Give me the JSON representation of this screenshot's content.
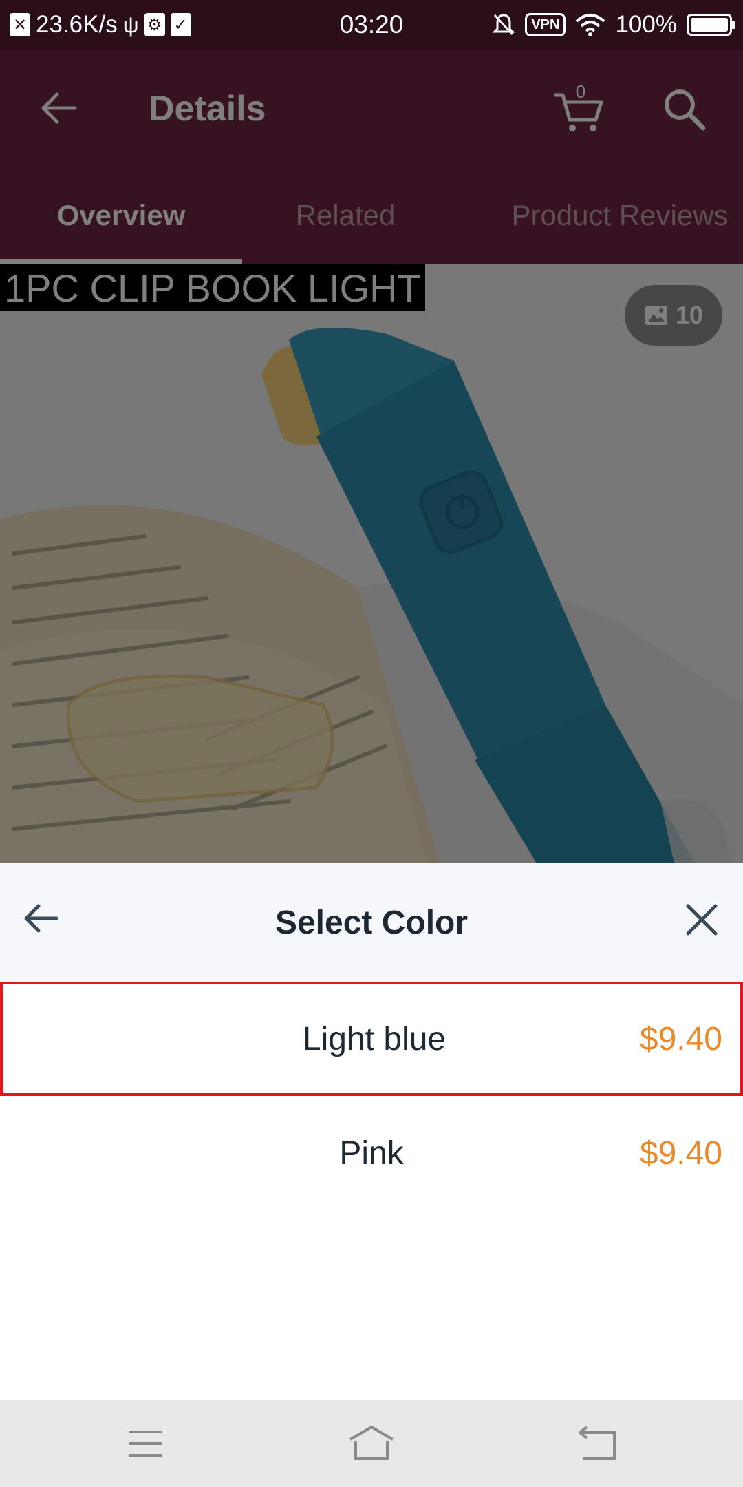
{
  "status_bar": {
    "network_speed": "23.6K/s",
    "time": "03:20",
    "vpn_label": "VPN",
    "battery": "100%"
  },
  "header": {
    "title": "Details",
    "cart_count": "0",
    "icons": [
      "back-arrow-icon",
      "cart-icon",
      "search-icon"
    ]
  },
  "tabs": [
    {
      "label": "Overview",
      "active": true
    },
    {
      "label": "Related",
      "active": false
    },
    {
      "label": "Product Reviews",
      "active": false
    }
  ],
  "product": {
    "banner_text": "1PC CLIP BOOK LIGHT",
    "photo_count": "10",
    "photo_icon": "image-icon"
  },
  "sheet": {
    "title": "Select Color",
    "options": [
      {
        "label": "Light blue",
        "price": "$9.40",
        "selected": true
      },
      {
        "label": "Pink",
        "price": "$9.40",
        "selected": false
      }
    ]
  },
  "nav": {
    "icons": [
      "menu-icon",
      "home-icon",
      "back-icon"
    ]
  },
  "colors": {
    "brand_header": "#6e2446",
    "status_bar": "#2a0f1a",
    "price": "#e98a2c",
    "selected_border": "#e3161b",
    "sheet_header_bg": "#f5f7fa",
    "text_dark": "#1d2833"
  }
}
